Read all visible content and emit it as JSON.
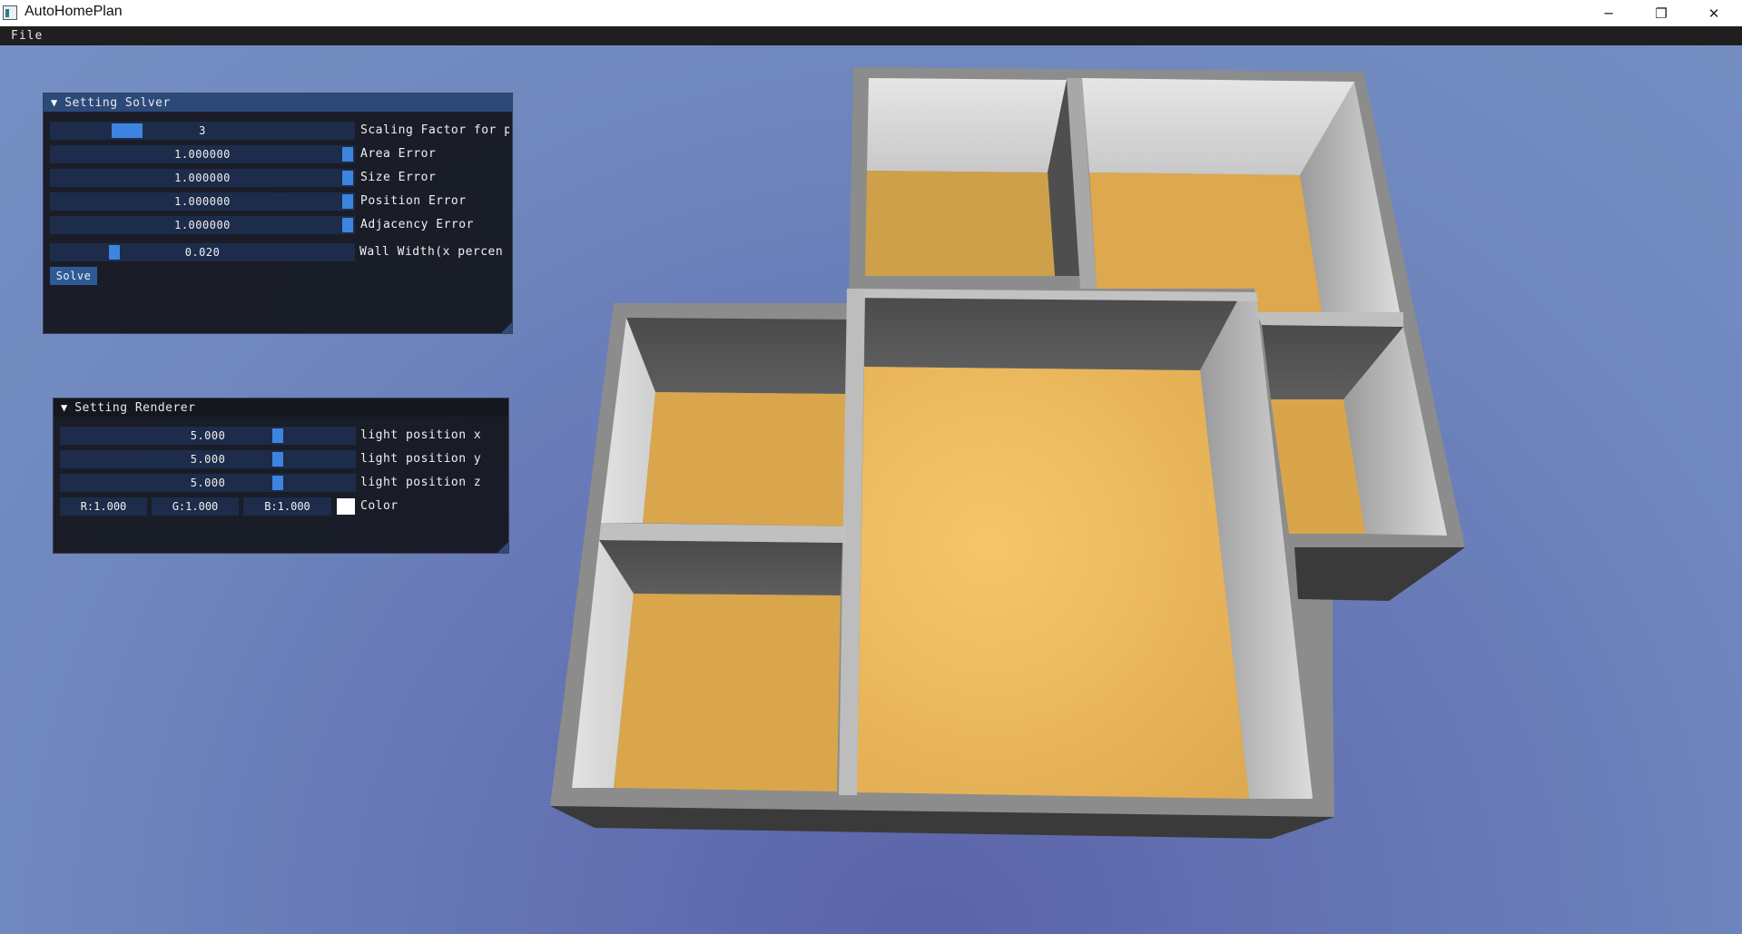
{
  "window": {
    "title": "AutoHomePlan",
    "minimize_glyph": "─",
    "maximize_glyph": "❐",
    "close_glyph": "✕"
  },
  "menu": {
    "file_label": "File"
  },
  "solver_panel": {
    "title": "Setting Solver",
    "collapse_glyph": "▼",
    "rows": [
      {
        "value": "3",
        "label": "Scaling Factor for p"
      },
      {
        "value": "1.000000",
        "label": "Area Error"
      },
      {
        "value": "1.000000",
        "label": "Size Error"
      },
      {
        "value": "1.000000",
        "label": "Position Error"
      },
      {
        "value": "1.000000",
        "label": "Adjacency Error"
      },
      {
        "value": "0.020",
        "label": "Wall Width(x percen"
      }
    ],
    "solve_label": "Solve"
  },
  "renderer_panel": {
    "title": "Setting Renderer",
    "collapse_glyph": "▼",
    "rows": [
      {
        "value": "5.000",
        "label": "light position x"
      },
      {
        "value": "5.000",
        "label": "light position y"
      },
      {
        "value": "5.000",
        "label": "light position z"
      }
    ],
    "color": {
      "r": "R:1.000",
      "g": "G:1.000",
      "b": "B:1.000",
      "label": "Color",
      "swatch": "#ffffff"
    }
  },
  "colors": {
    "floor": "#e1ad50",
    "wall_top": "#8c8c8c",
    "accent": "#3d84e0"
  }
}
